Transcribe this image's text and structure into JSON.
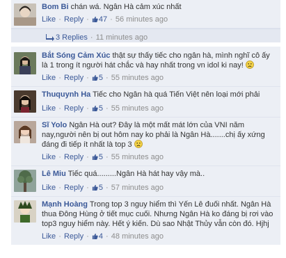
{
  "comments": [
    {
      "name": "Bom Bi",
      "text": "chán wá. Ngân Hà cảm xúc nhất",
      "like_label": "Like",
      "reply_label": "Reply",
      "likes": "47",
      "time": "56 minutes ago",
      "emoticon": false
    },
    {
      "name": "Bắt Sóng Cảm Xúc",
      "text": "thật sự thấy tiếc cho ngân hà, mình nghĩ cô ấy là 1 trong ít người hát chắc và hay nhất trong vn idol ki nay!",
      "like_label": "Like",
      "reply_label": "Reply",
      "likes": "5",
      "time": "55 minutes ago",
      "emoticon": true
    },
    {
      "name": "Thuquynh Ha",
      "text": "Tiếc cho Ngân hà quá Tiến Việt nên loại mới phải",
      "like_label": "Like",
      "reply_label": "Reply",
      "likes": "5",
      "time": "55 minutes ago",
      "emoticon": false
    },
    {
      "name": "Sĩ Yolo",
      "text": "Ngân Hà out? Đây là một mất mát lớn của VNI năm nay,người nên bị out hôm nay ko phải là Ngân Hà.......chị ấy xứng đáng đi tiếp ít nhất là top 3",
      "like_label": "Like",
      "reply_label": "Reply",
      "likes": "5",
      "time": "55 minutes ago",
      "emoticon": true
    },
    {
      "name": "Lê Miu",
      "text": "Tiếc quá.........Ngân Hà hát hay vậy mà..",
      "like_label": "Like",
      "reply_label": "Reply",
      "likes": "5",
      "time": "57 minutes ago",
      "emoticon": false
    },
    {
      "name": "Mạnh Hoàng",
      "text": "Trong top 3 nguy hiểm thì Yến Lê đuối nhất. Ngân Hà thua Đông Hùng ở tiết mục cuối. Nhưng Ngân Hà ko đáng bị rơi vào top3 nguy hiểm này. Hết ý kiến. Dù sao Nhật Thủy vẫn còn đó. Hjhj",
      "like_label": "Like",
      "reply_label": "Reply",
      "likes": "4",
      "time": "48 minutes ago",
      "emoticon": false
    }
  ],
  "replies_bar": {
    "label": "3 Replies",
    "time": "11 minutes ago"
  },
  "colors": {
    "link": "#3b5998",
    "comment_bg": "#eceff5",
    "meta": "#8d8d8d"
  }
}
